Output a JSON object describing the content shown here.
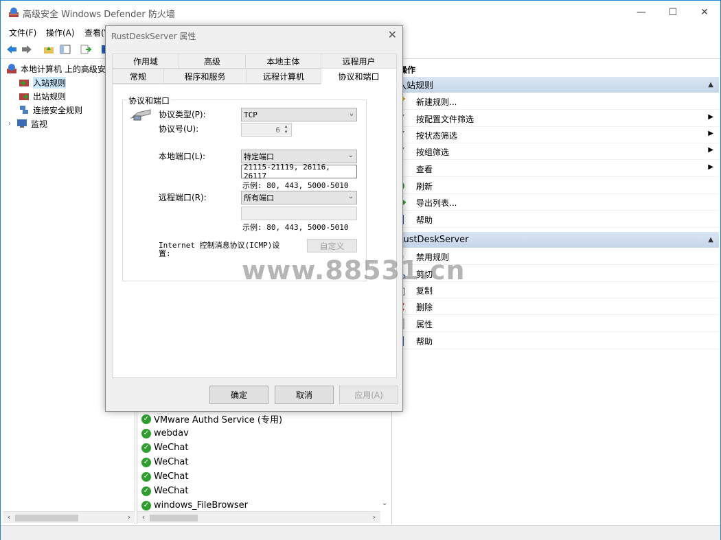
{
  "window": {
    "title": "高级安全 Windows Defender 防火墙",
    "minimize": "—",
    "maximize": "☐",
    "close": "✕"
  },
  "menu": [
    "文件(F)",
    "操作(A)",
    "查看(V)"
  ],
  "tree": {
    "root": "本地计算机 上的高级安全",
    "items": [
      "入站规则",
      "出站规则",
      "连接安全规则",
      "监视"
    ]
  },
  "rules_list": [
    "VMware Authd Service (专用)",
    "webdav",
    "WeChat",
    "WeChat",
    "WeChat",
    "WeChat",
    "windows_FileBrowser"
  ],
  "actions": {
    "header": "操作",
    "section1": "入站规则",
    "section1_items": [
      "新建规则...",
      "按配置文件筛选",
      "按状态筛选",
      "按组筛选",
      "查看",
      "刷新",
      "导出列表...",
      "帮助"
    ],
    "section2": "RustDeskServer",
    "section2_items": [
      "禁用规则",
      "剪切",
      "复制",
      "删除",
      "属性",
      "帮助"
    ]
  },
  "dialog": {
    "title": "RustDeskServer 属性",
    "tabs_row1": [
      "作用域",
      "高级",
      "本地主体",
      "远程用户"
    ],
    "tabs_row2": [
      "常规",
      "程序和服务",
      "远程计算机",
      "协议和端口"
    ],
    "group_title": "协议和端口",
    "protocol_type_label": "协议类型(P):",
    "protocol_type_value": "TCP",
    "protocol_number_label": "协议号(U):",
    "protocol_number_value": "6",
    "local_port_label": "本地端口(L):",
    "local_port_value": "特定端口",
    "local_port_text": "21115-21119, 26116, 26117",
    "local_example": "示例: 80, 443, 5000-5010",
    "remote_port_label": "远程端口(R):",
    "remote_port_value": "所有端口",
    "remote_port_text": "",
    "remote_example": "示例: 80, 443, 5000-5010",
    "icmp_label_1": "Internet 控制消息协议(ICMP)设",
    "icmp_label_2": "置:",
    "customize_button": "自定义",
    "ok": "确定",
    "cancel": "取消",
    "apply": "应用(A)"
  },
  "watermark": "www.88531.cn"
}
